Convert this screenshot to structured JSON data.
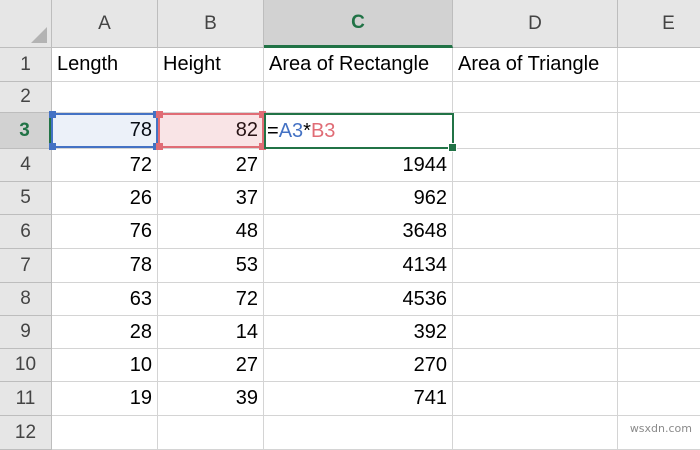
{
  "columns": [
    "A",
    "B",
    "C",
    "D",
    "E"
  ],
  "rows": [
    "1",
    "2",
    "3",
    "4",
    "5",
    "6",
    "7",
    "8",
    "9",
    "10",
    "11",
    "12"
  ],
  "active_cell": {
    "column": "C",
    "row": "3"
  },
  "formula": {
    "op_eq": "=",
    "ref_a": "A3",
    "op_mul": "*",
    "ref_b": "B3"
  },
  "grid": [
    [
      "Length",
      "Height",
      "Area of Rectangle",
      "Area of Triangle",
      ""
    ],
    [
      "",
      "",
      "",
      "",
      ""
    ],
    [
      "78",
      "82",
      "",
      "",
      ""
    ],
    [
      "72",
      "27",
      "1944",
      "",
      ""
    ],
    [
      "26",
      "37",
      "962",
      "",
      ""
    ],
    [
      "76",
      "48",
      "3648",
      "",
      ""
    ],
    [
      "78",
      "53",
      "4134",
      "",
      ""
    ],
    [
      "63",
      "72",
      "4536",
      "",
      ""
    ],
    [
      "28",
      "14",
      "392",
      "",
      ""
    ],
    [
      "10",
      "27",
      "270",
      "",
      ""
    ],
    [
      "19",
      "39",
      "741",
      "",
      ""
    ],
    [
      "",
      "",
      "",
      "",
      ""
    ]
  ],
  "watermark": "wsxdn.com",
  "colors": {
    "accent": "#217346",
    "ref_a": "#4472c4",
    "ref_b": "#e06c75"
  }
}
